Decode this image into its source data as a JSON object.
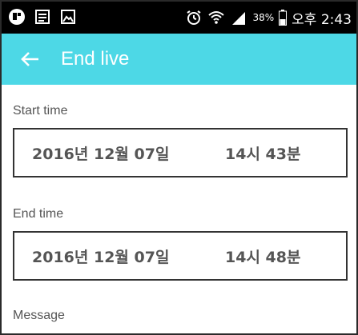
{
  "status_bar": {
    "battery": "38%",
    "time": "오후 2:43",
    "icons": [
      "notification-app-icon",
      "message-icon",
      "image-icon",
      "alarm-icon",
      "wifi-icon",
      "signal-icon",
      "battery-icon"
    ]
  },
  "app_bar": {
    "title": "End live",
    "back_icon": "arrow-left-icon"
  },
  "colors": {
    "app_bar": "#4dd8e6",
    "status_bar": "#000000",
    "label": "#555555",
    "box_border": "#333333"
  },
  "form": {
    "start": {
      "label": "Start time",
      "date": "2016년 12월 07일",
      "time": "14시 43분"
    },
    "end": {
      "label": "End time",
      "date": "2016년 12월 07일",
      "time": "14시 48분"
    },
    "message": {
      "label": "Message"
    }
  }
}
